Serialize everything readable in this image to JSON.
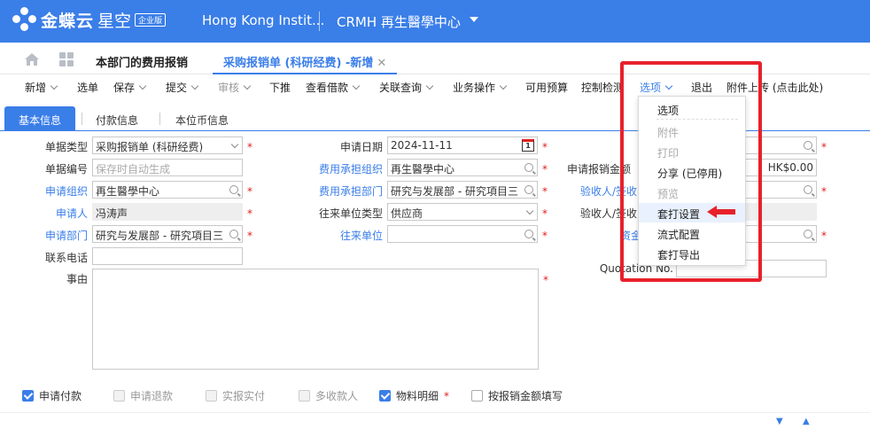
{
  "header": {
    "brand": "金蝶云",
    "brand_sub": "星空",
    "edition": "企业版",
    "org": "Hong Kong Instit...",
    "crmh": "CRMH  再生醫學中心"
  },
  "tabs": {
    "tab1": "本部门的费用报销",
    "tab2": "采购报销单 (科研经费) -新增",
    "close": "✕"
  },
  "toolbar": {
    "new": "新增",
    "select": "选单",
    "save": "保存",
    "submit": "提交",
    "audit": "审核",
    "push": "下推",
    "view_borrow": "查看借款",
    "related_query": "关联查询",
    "business_ops": "业务操作",
    "available_budget": "可用预算",
    "control_check": "控制检测",
    "options": "选项",
    "exit": "退出",
    "attach_upload": "附件上传 (点击此处)"
  },
  "subtabs": [
    "基本信息",
    "付款信息",
    "本位币信息"
  ],
  "form": {
    "doc_type_label": "单据类型",
    "doc_type_value": "采购报销单 (科研经费)",
    "doc_no_label": "单据编号",
    "doc_no_placeholder": "保存时自动生成",
    "apply_org_label": "申请组织",
    "apply_org_value": "再生醫學中心",
    "applicant_label": "申请人",
    "applicant_value": "冯涛声",
    "apply_dept_label": "申请部门",
    "apply_dept_value": "研究与发展部 - 研究項目三",
    "phone_label": "联系电话",
    "reason_label": "事由",
    "apply_date_label": "申请日期",
    "apply_date_value": "2024-11-11",
    "cost_org_label": "费用承担组织",
    "cost_org_value": "再生醫學中心",
    "cost_dept_label": "费用承担部门",
    "cost_dept_value": "研究与发展部 - 研究項目三",
    "partner_type_label": "往来单位类型",
    "partner_type_value": "供应商",
    "partner_label": "往来单位",
    "claim_amount_label": "申请报销金额",
    "claim_amount_value": "HK$0.00",
    "receiver_label": "验收人/签收",
    "receiver2_label": "验收人/签收",
    "fund_label": "资金",
    "quotation_label": "Quotation No.",
    "calendar_day": "1"
  },
  "checkboxes": [
    {
      "label": "申请付款",
      "checked": true,
      "disabled": false
    },
    {
      "label": "申请退款",
      "checked": false,
      "disabled": true
    },
    {
      "label": "实报实付",
      "checked": false,
      "disabled": true
    },
    {
      "label": "多收款人",
      "checked": false,
      "disabled": true
    },
    {
      "label": "物料明细",
      "checked": true,
      "disabled": false
    },
    {
      "label": "按报销金额填写",
      "checked": false,
      "disabled": false
    }
  ],
  "menu": {
    "items": [
      "选项",
      "附件",
      "打印",
      "分享 (已停用)",
      "预览",
      "套打设置",
      "流式配置",
      "套打导出"
    ]
  },
  "required_mark": "*"
}
